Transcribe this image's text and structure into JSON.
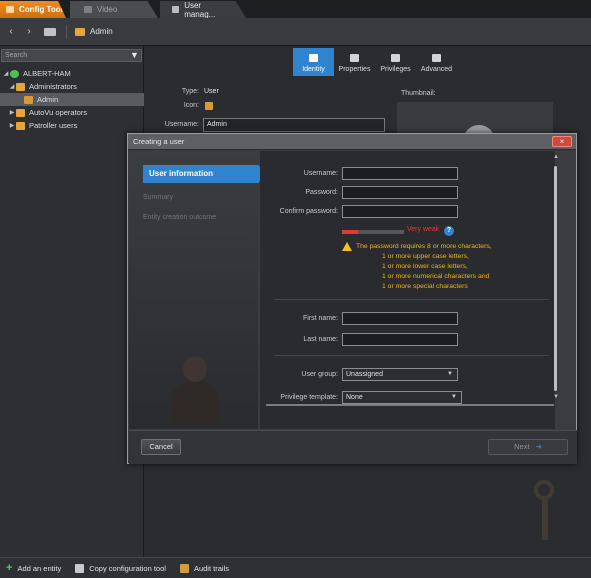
{
  "tabs": [
    {
      "label": "Config Tool",
      "active": false
    },
    {
      "label": "Video",
      "active": false
    },
    {
      "label": "User manag...",
      "active": true,
      "close": "×"
    }
  ],
  "nav": {
    "back": "‹",
    "forward": "›",
    "breadcrumb": "Admin"
  },
  "left": {
    "search_placeholder": "Search",
    "tree": [
      {
        "label": "ALBERT-HAM",
        "level": 0,
        "icon": "network-icon",
        "expanded": true
      },
      {
        "label": "Administrators",
        "level": 1,
        "icon": "group-icon",
        "expanded": true
      },
      {
        "label": "Admin",
        "level": 2,
        "icon": "user-icon",
        "selected": true
      },
      {
        "label": "AutoVu operators",
        "level": 1,
        "icon": "group-icon",
        "expanded": false
      },
      {
        "label": "Patroller users",
        "level": 1,
        "icon": "group-icon",
        "expanded": false
      }
    ]
  },
  "main": {
    "tabs": [
      {
        "label": "Identity",
        "active": true
      },
      {
        "label": "Properties",
        "active": false
      },
      {
        "label": "Privileges",
        "active": false
      },
      {
        "label": "Advanced",
        "active": false
      }
    ],
    "type_label": "Type:",
    "type_value": "User",
    "icon_label": "Icon:",
    "username_label": "Username:",
    "username_value": "Admin",
    "thumbnail_label": "Thumbnail:"
  },
  "dialog": {
    "title": "Creating a user",
    "close": "×",
    "steps": [
      {
        "label": "User information",
        "active": true
      },
      {
        "label": "Summary",
        "active": false
      },
      {
        "label": "Entity creation outcome",
        "active": false
      }
    ],
    "form": {
      "username_label": "Username:",
      "password_label": "Password:",
      "confirm_label": "Confirm password:",
      "strength_label": "Very weak",
      "strength_level": 0.25,
      "warning_lines": [
        "The password requires 8 or more characters,",
        "1 or more upper case letters,",
        "1 or more lower case letters,",
        "1 or more numerical characters and",
        "1 or more special characters"
      ],
      "first_name_label": "First name:",
      "last_name_label": "Last name:",
      "user_group_label": "User group:",
      "user_group_value": "Unassigned",
      "privilege_label": "Privilege template:",
      "privilege_value": "None"
    },
    "cancel": "Cancel",
    "next": "Next"
  },
  "bottom": [
    {
      "label": "Add an entity",
      "icon": "plus-icon"
    },
    {
      "label": "Copy configuration tool",
      "icon": "copy-icon"
    },
    {
      "label": "Audit trails",
      "icon": "audit-icon"
    }
  ],
  "colors": {
    "accent": "#2f84cf",
    "config_tab": "#f08a1e",
    "warning": "#f2b21c",
    "weak": "#e03a32"
  }
}
